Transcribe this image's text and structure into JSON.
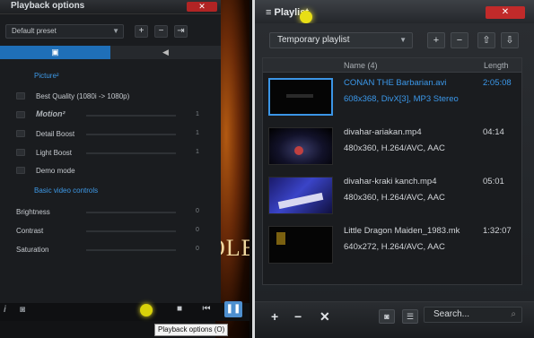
{
  "left": {
    "title": "Playback options",
    "preset": "Default preset",
    "movie_overlay_text": "OLE",
    "tabs": {
      "video": "▣",
      "audio": "◀"
    },
    "picture_section": "Picture²",
    "options": [
      {
        "label": "Best Quality (1080i -> 1080p)",
        "value": ""
      },
      {
        "label": "Motion²",
        "value": "1"
      },
      {
        "label": "Detail Boost",
        "value": "1"
      },
      {
        "label": "Light Boost",
        "value": "1"
      },
      {
        "label": "Demo mode",
        "value": ""
      }
    ],
    "basic_section": "Basic video controls",
    "controls": [
      {
        "label": "Brightness",
        "value": "0"
      },
      {
        "label": "Contrast",
        "value": "0"
      },
      {
        "label": "Saturation",
        "value": "0"
      }
    ],
    "tooltip": "Playback options (O)"
  },
  "right": {
    "title": "Playlist",
    "playlist_name": "Temporary playlist",
    "column_name": "Name (4)",
    "column_length": "Length",
    "items": [
      {
        "name": "CONAN THE Barbarian.avi",
        "info": "608x368, DivX[3], MP3 Stereo",
        "length": "2:05:08",
        "selected": true
      },
      {
        "name": "divahar-ariakan.mp4",
        "info": "480x360, H.264/AVC, AAC",
        "length": "04:14",
        "selected": false
      },
      {
        "name": "divahar-kraki kanch.mp4",
        "info": "480x360, H.264/AVC, AAC",
        "length": "05:01",
        "selected": false
      },
      {
        "name": "Little Dragon Maiden_1983.mk",
        "info": "640x272, H.264/AVC, AAC",
        "length": "1:32:07",
        "selected": false
      }
    ],
    "search_placeholder": "Search..."
  },
  "colors": {
    "accent_blue": "#3b95e6",
    "close_red": "#c12a2a",
    "highlight_yellow": "#e7de16"
  }
}
